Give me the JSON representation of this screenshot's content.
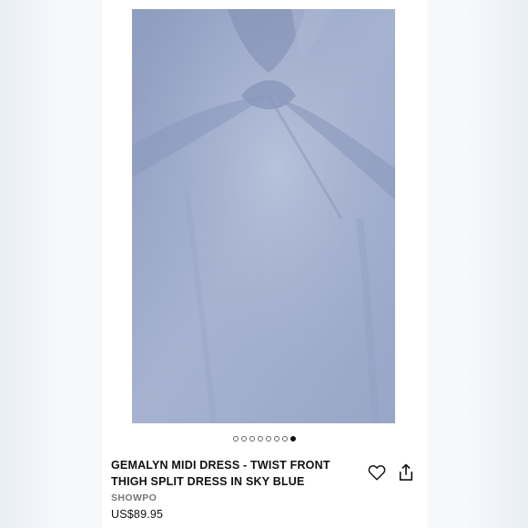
{
  "product": {
    "title": "GEMALYN MIDI DRESS - TWIST FRONT THIGH SPLIT DRESS IN SKY BLUE",
    "brand": "SHOWPO",
    "price": "US$89.95"
  },
  "gallery": {
    "total_images": 8,
    "active_index": 7
  },
  "icons": {
    "wishlist": "heart-icon",
    "share": "share-icon"
  },
  "colors": {
    "dress": "#9faccc",
    "text": "#111111",
    "brand_text": "#777777"
  }
}
